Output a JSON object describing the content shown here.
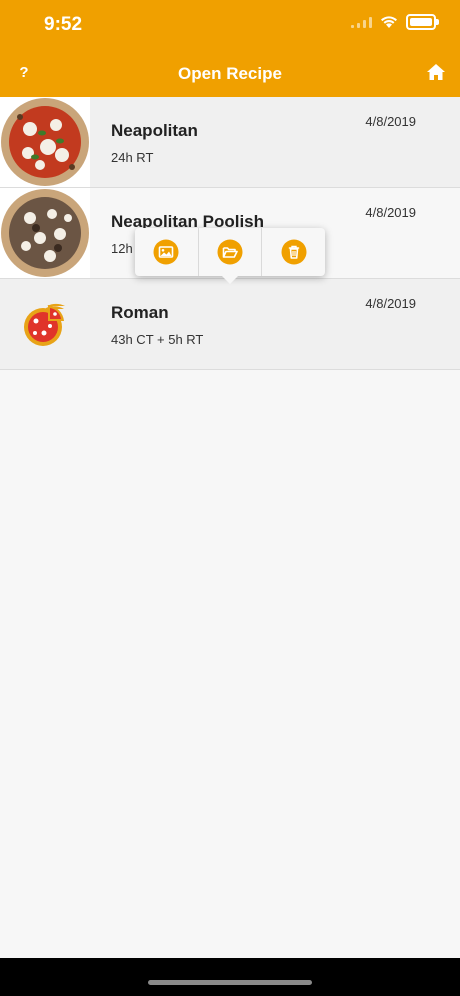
{
  "status_bar": {
    "time": "9:52"
  },
  "nav": {
    "help_label": "?",
    "title": "Open Recipe"
  },
  "recipes": [
    {
      "title": "Neapolitan",
      "subtitle": "24h RT",
      "date": "4/8/2019"
    },
    {
      "title": "Neapolitan Poolish",
      "subtitle": "12h",
      "date": "4/8/2019"
    },
    {
      "title": "Roman",
      "subtitle": "43h CT + 5h RT",
      "date": "4/8/2019"
    }
  ],
  "popover_actions": [
    {
      "icon": "image-icon"
    },
    {
      "icon": "folder-open-icon"
    },
    {
      "icon": "trash-icon"
    }
  ],
  "colors": {
    "accent": "#f0a000",
    "background": "#f7f7f7"
  }
}
